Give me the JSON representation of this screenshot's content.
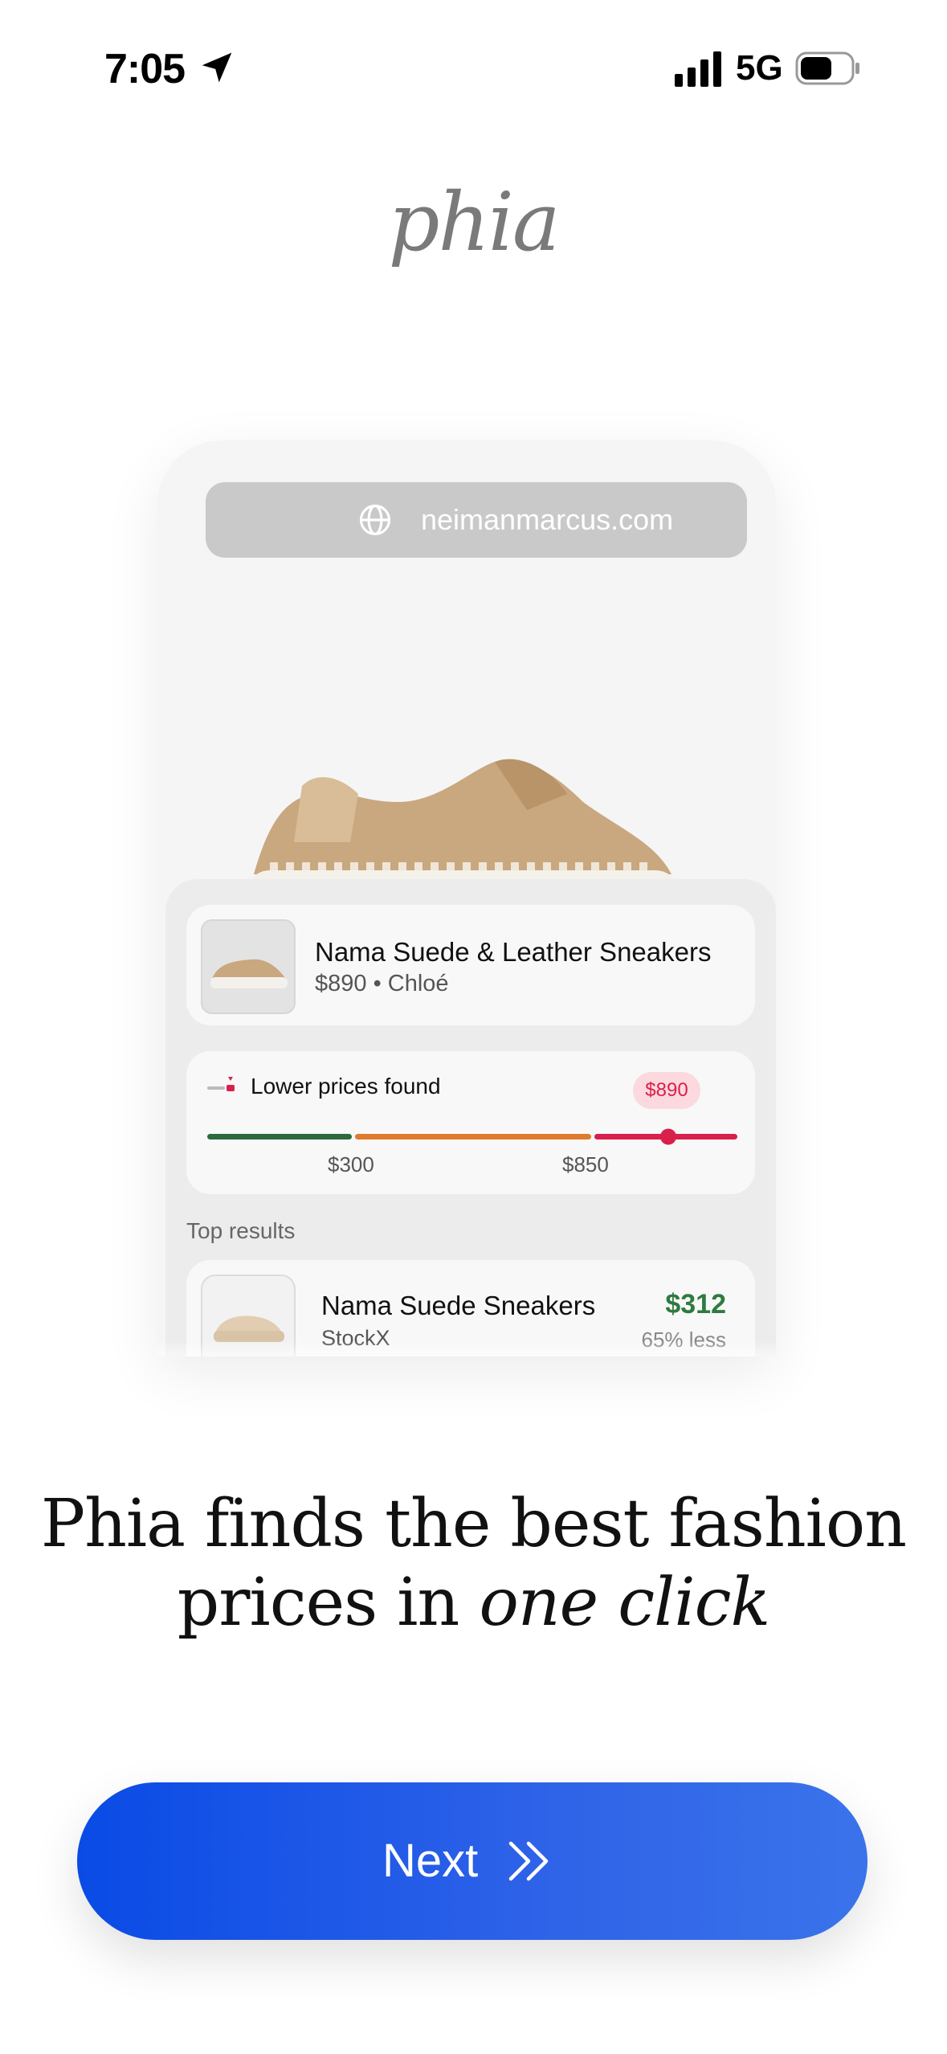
{
  "status_bar": {
    "time": "7:05",
    "network": "5G"
  },
  "logo": "phia",
  "mockup": {
    "url": "neimanmarcus.com",
    "product": {
      "name": "Nama Suede & Leather Sneakers",
      "subtitle": "$890 • Chloé"
    },
    "price_check": {
      "title": "Lower prices found",
      "current_price": "$890",
      "markers": [
        "$300",
        "$850"
      ],
      "colors": {
        "low": "#2d6a3e",
        "mid": "#e07a2e",
        "high": "#d9204a"
      }
    },
    "top_results_label": "Top results",
    "result": {
      "name": "Nama Suede Sneakers",
      "store": "StockX",
      "price": "$312",
      "savings": "65% less"
    }
  },
  "headline": {
    "line1": "Phia finds the best fashion",
    "line2_plain": "prices in",
    "line2_italic": "one click"
  },
  "next_button": {
    "label": "Next"
  },
  "colors": {
    "accent": "#0a4be6",
    "result_price": "#2f7a3f"
  }
}
